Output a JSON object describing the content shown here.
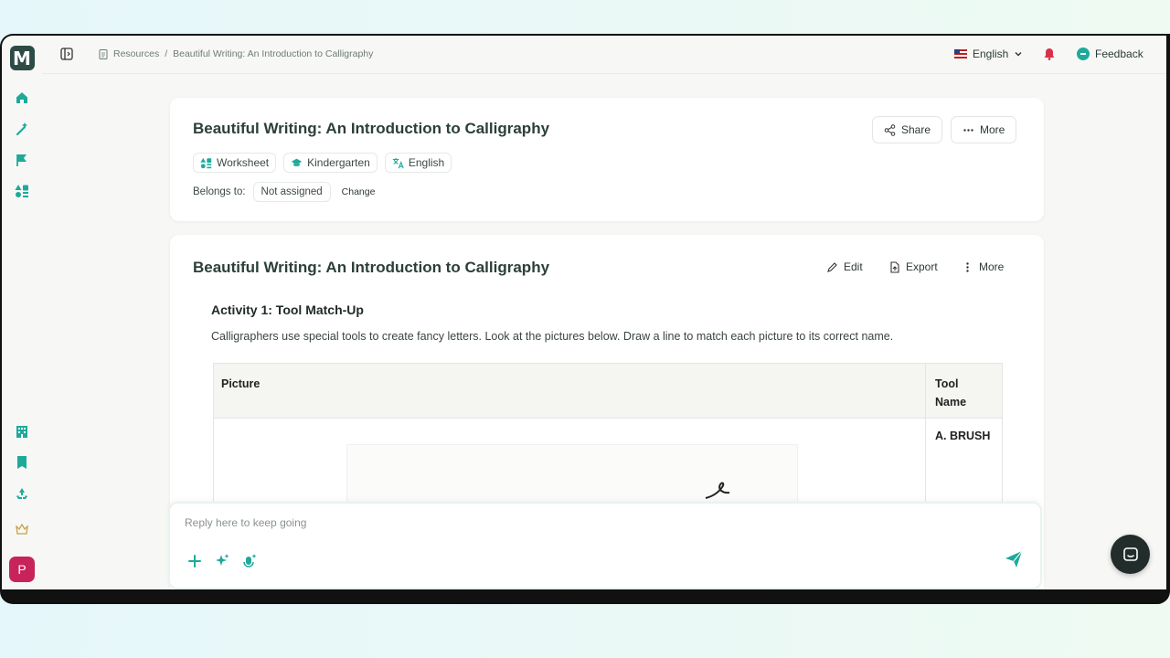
{
  "topbar": {
    "breadcrumb": [
      "Resources",
      "/",
      "Beautiful Writing: An Introduction to Calligraphy"
    ],
    "language": "English",
    "feedback_label": "Feedback"
  },
  "sidebar": {
    "logo_letter": "M",
    "avatar_letter": "P",
    "icons": [
      "home-icon",
      "magic-wand-icon",
      "flag-icon",
      "shapes-icon",
      "building-icon",
      "bookmark-icon",
      "recycle-icon",
      "crown-icon"
    ]
  },
  "header_card": {
    "title": "Beautiful Writing: An Introduction to Calligraphy",
    "share_label": "Share",
    "more_label": "More",
    "tags": [
      "Worksheet",
      "Kindergarten",
      "English"
    ],
    "belongs_label": "Belongs to:",
    "belongs_value": "Not assigned",
    "change_label": "Change"
  },
  "content_card": {
    "title": "Beautiful Writing: An Introduction to Calligraphy",
    "edit_label": "Edit",
    "export_label": "Export",
    "more_label": "More",
    "activity_title": "Activity 1: Tool Match-Up",
    "instructions": "Calligraphers use special tools to create fancy letters. Look at the pictures below. Draw a line to match each picture to its correct name.",
    "table": {
      "headers": [
        "Picture",
        "Tool Name"
      ],
      "rows": [
        [
          "",
          "A. BRUSH"
        ]
      ]
    }
  },
  "reply": {
    "placeholder": "Reply here to keep going"
  },
  "colors": {
    "accent": "#1fa99b",
    "logo_bg": "#2d4b45",
    "avatar_bg": "#c8235a",
    "bell": "#d9304a"
  }
}
